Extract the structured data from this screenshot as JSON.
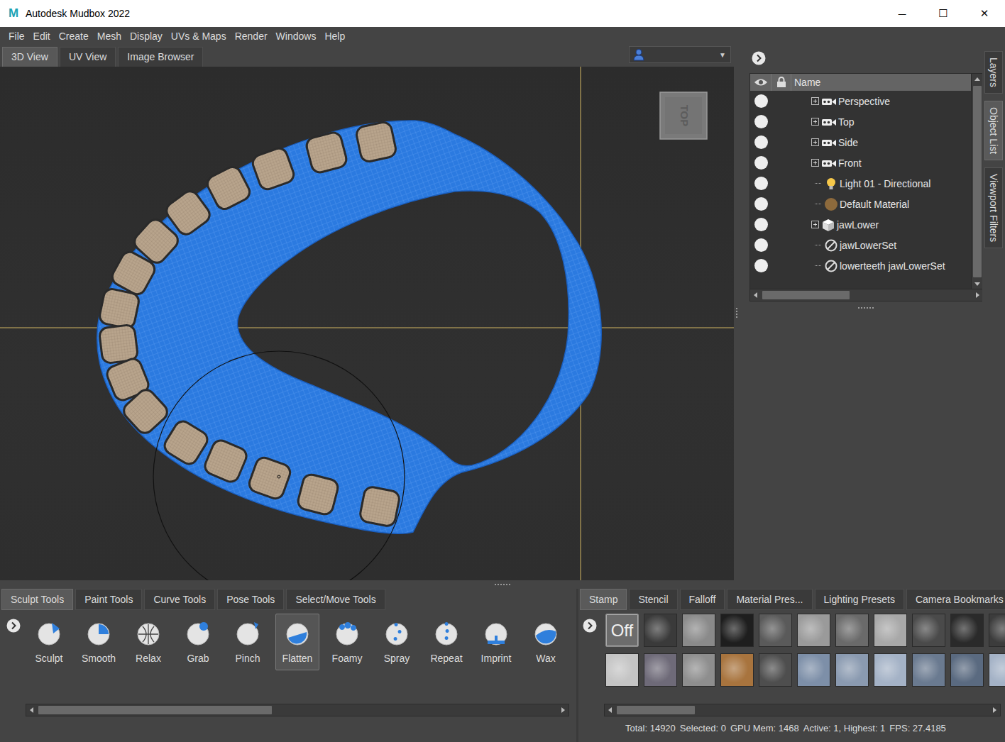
{
  "window": {
    "title": "Autodesk Mudbox 2022",
    "logo": "M",
    "controls": [
      "─",
      "☐",
      "✕"
    ]
  },
  "menu": [
    "File",
    "Edit",
    "Create",
    "Mesh",
    "Display",
    "UVs & Maps",
    "Render",
    "Windows",
    "Help"
  ],
  "view_tabs": [
    {
      "label": "3D View",
      "selected": true
    },
    {
      "label": "UV View",
      "selected": false
    },
    {
      "label": "Image Browser",
      "selected": false
    }
  ],
  "camera_dropdown": {
    "arrow": "▼"
  },
  "viewport": {
    "view_cube": "TOP"
  },
  "object_panel": {
    "side_tabs": [
      {
        "label": "Layers",
        "selected": false
      },
      {
        "label": "Object List",
        "selected": true
      },
      {
        "label": "Viewport Filters",
        "selected": false
      }
    ],
    "columns": [
      "Name"
    ],
    "rows": [
      {
        "name": "Perspective",
        "kind": "camera",
        "expandable": true,
        "expanded": false,
        "visible": true
      },
      {
        "name": "Top",
        "kind": "camera",
        "expandable": true,
        "expanded": false,
        "visible": true
      },
      {
        "name": "Side",
        "kind": "camera",
        "expandable": true,
        "expanded": false,
        "visible": true
      },
      {
        "name": "Front",
        "kind": "camera",
        "expandable": true,
        "expanded": false,
        "visible": true
      },
      {
        "name": "Light 01 - Directional",
        "kind": "light",
        "expandable": false,
        "expanded": false,
        "visible": true
      },
      {
        "name": "Default Material",
        "kind": "material",
        "expandable": false,
        "expanded": false,
        "visible": true
      },
      {
        "name": "jawLower",
        "kind": "mesh",
        "expandable": true,
        "expanded": false,
        "visible": true
      },
      {
        "name": "jawLowerSet",
        "kind": "set",
        "expandable": false,
        "expanded": false,
        "visible": true
      },
      {
        "name": "lowerteeth jawLowerSet",
        "kind": "set",
        "expandable": false,
        "expanded": false,
        "visible": true
      }
    ]
  },
  "tool_tabs": [
    {
      "label": "Sculpt Tools",
      "selected": true
    },
    {
      "label": "Paint Tools",
      "selected": false
    },
    {
      "label": "Curve Tools",
      "selected": false
    },
    {
      "label": "Pose Tools",
      "selected": false
    },
    {
      "label": "Select/Move Tools",
      "selected": false
    }
  ],
  "tools": [
    {
      "label": "Sculpt",
      "selected": false
    },
    {
      "label": "Smooth",
      "selected": false
    },
    {
      "label": "Relax",
      "selected": false
    },
    {
      "label": "Grab",
      "selected": false
    },
    {
      "label": "Pinch",
      "selected": false
    },
    {
      "label": "Flatten",
      "selected": true
    },
    {
      "label": "Foamy",
      "selected": false
    },
    {
      "label": "Spray",
      "selected": false
    },
    {
      "label": "Repeat",
      "selected": false
    },
    {
      "label": "Imprint",
      "selected": false
    },
    {
      "label": "Wax",
      "selected": false
    }
  ],
  "tools_scroll": {
    "level": 0.45
  },
  "stamp_tabs": [
    {
      "label": "Stamp",
      "selected": true
    },
    {
      "label": "Stencil",
      "selected": false
    },
    {
      "label": "Falloff",
      "selected": false
    },
    {
      "label": "Material Pres...",
      "selected": false
    },
    {
      "label": "Lighting Presets",
      "selected": false
    },
    {
      "label": "Camera Bookmarks",
      "selected": false
    }
  ],
  "stamps": [
    {
      "kind": "off",
      "label": "Off",
      "selected": true
    },
    {
      "kind": "texture",
      "color": "#3a3a3a",
      "selected": false
    },
    {
      "kind": "texture",
      "color": "#8a8a8a",
      "selected": false
    },
    {
      "kind": "texture",
      "color": "#1e1e1e",
      "selected": false
    },
    {
      "kind": "texture",
      "color": "#5a5a5a",
      "selected": false
    },
    {
      "kind": "texture",
      "color": "#9a9a9a",
      "selected": false
    },
    {
      "kind": "texture",
      "color": "#6a6a6a",
      "selected": false
    },
    {
      "kind": "texture",
      "color": "#a8a8a8",
      "selected": false
    },
    {
      "kind": "texture",
      "color": "#4a4a4a",
      "selected": false
    },
    {
      "kind": "texture",
      "color": "#2a2a2a",
      "selected": false
    },
    {
      "kind": "texture",
      "color": "#3c3c3c",
      "selected": false
    },
    {
      "kind": "texture",
      "color": "#c4c4c4",
      "selected": false
    },
    {
      "kind": "texture",
      "color": "#6e6a78",
      "selected": false
    },
    {
      "kind": "texture",
      "color": "#8e8e8e",
      "selected": false
    },
    {
      "kind": "texture",
      "color": "#a8743e",
      "selected": false
    },
    {
      "kind": "texture",
      "color": "#4e4e4e",
      "selected": false
    },
    {
      "kind": "texture",
      "color": "#7d8fa8",
      "selected": false
    },
    {
      "kind": "texture",
      "color": "#8a9ab0",
      "selected": false
    },
    {
      "kind": "texture",
      "color": "#a4b2c6",
      "selected": false
    },
    {
      "kind": "texture",
      "color": "#6a7a90",
      "selected": false
    },
    {
      "kind": "texture",
      "color": "#5a6a80",
      "selected": false
    },
    {
      "kind": "texture",
      "color": "#a4b2c6",
      "selected": false
    }
  ],
  "stamps_scroll": {
    "level": 0.21
  },
  "status_bar": [
    "Total: 14920",
    "Selected: 0",
    "GPU Mem: 1468",
    "Active: 1, Highest: 1",
    "FPS: 27.4185"
  ]
}
